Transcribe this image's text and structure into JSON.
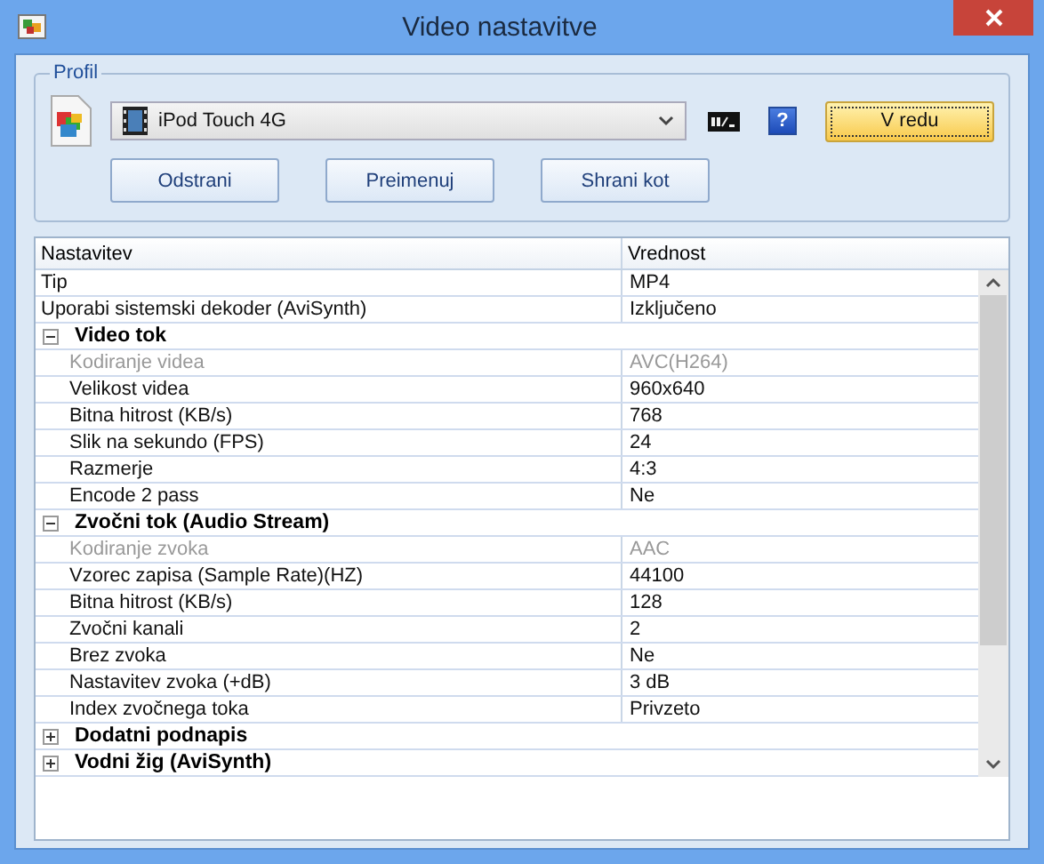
{
  "window": {
    "title": "Video nastavitve"
  },
  "profile": {
    "label": "Profil",
    "preset": "iPod Touch 4G",
    "help_button": "?",
    "ok_button": "V redu",
    "buttons": [
      "Odstrani",
      "Preimenuj",
      "Shrani kot"
    ]
  },
  "table": {
    "columns": [
      "Nastavitev",
      "Vrednost"
    ],
    "rows": [
      {
        "kind": "property",
        "name": "Tip",
        "value": "MP4",
        "disabled": false
      },
      {
        "kind": "property",
        "name": "Uporabi sistemski dekoder (AviSynth)",
        "value": "Izključeno",
        "disabled": false
      },
      {
        "kind": "group",
        "name": "Video tok",
        "expanded": true,
        "children": [
          {
            "kind": "property",
            "name": "Kodiranje videa",
            "value": "AVC(H264)",
            "disabled": true
          },
          {
            "kind": "property",
            "name": "Velikost videa",
            "value": "960x640",
            "disabled": false
          },
          {
            "kind": "property",
            "name": "Bitna hitrost (KB/s)",
            "value": "768",
            "disabled": false
          },
          {
            "kind": "property",
            "name": "Slik na sekundo (FPS)",
            "value": "24",
            "disabled": false
          },
          {
            "kind": "property",
            "name": "Razmerje",
            "value": "4:3",
            "disabled": false
          },
          {
            "kind": "property",
            "name": "Encode 2 pass",
            "value": "Ne",
            "disabled": false
          }
        ]
      },
      {
        "kind": "group",
        "name": "Zvočni tok (Audio Stream)",
        "expanded": true,
        "children": [
          {
            "kind": "property",
            "name": "Kodiranje zvoka",
            "value": "AAC",
            "disabled": true
          },
          {
            "kind": "property",
            "name": "Vzorec zapisa (Sample Rate)(HZ)",
            "value": "44100",
            "disabled": false
          },
          {
            "kind": "property",
            "name": "Bitna hitrost (KB/s)",
            "value": "128",
            "disabled": false
          },
          {
            "kind": "property",
            "name": "Zvočni kanali",
            "value": "2",
            "disabled": false
          },
          {
            "kind": "property",
            "name": "Brez zvoka",
            "value": "Ne",
            "disabled": false
          },
          {
            "kind": "property",
            "name": "Nastavitev zvoka (+dB)",
            "value": "3 dB",
            "disabled": false
          },
          {
            "kind": "property",
            "name": "Index zvočnega toka",
            "value": "Privzeto",
            "disabled": false
          }
        ]
      },
      {
        "kind": "group",
        "name": "Dodatni podnapis",
        "expanded": false
      },
      {
        "kind": "group",
        "name": "Vodni žig (AviSynth)",
        "expanded": false
      }
    ]
  }
}
